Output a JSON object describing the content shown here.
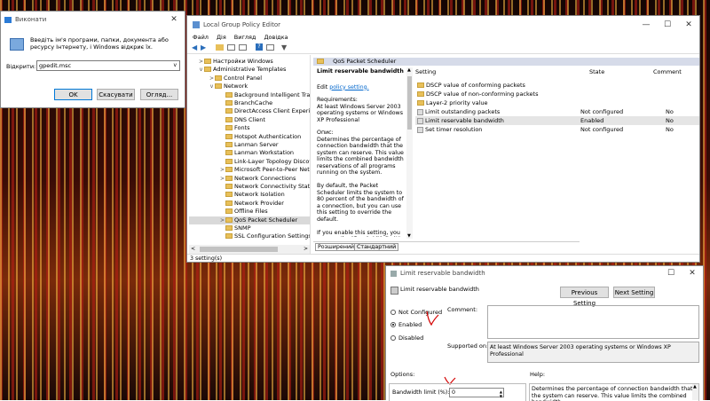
{
  "run_dialog": {
    "title": "Виконати",
    "description": "Введіть ім'я програми, папки, документа або ресурсу Інтернету, і Windows відкриє їх.",
    "open_label": "Відкрити:",
    "open_value": "gpedit.msc",
    "ok_label": "OK",
    "cancel_label": "Скасувати",
    "browse_label": "Огляд..."
  },
  "gpe": {
    "title": "Local Group Policy Editor",
    "menu": [
      "Файл",
      "Дія",
      "Вигляд",
      "Довідка"
    ],
    "tree": [
      {
        "label": "Настройки Windows",
        "depth": 0,
        "arrow": ">"
      },
      {
        "label": "Administrative Templates",
        "depth": 0,
        "arrow": "v"
      },
      {
        "label": "Control Panel",
        "depth": 1,
        "arrow": ">"
      },
      {
        "label": "Network",
        "depth": 1,
        "arrow": "v"
      },
      {
        "label": "Background Intelligent Tran",
        "depth": 2,
        "arrow": ""
      },
      {
        "label": "BranchCache",
        "depth": 2,
        "arrow": ""
      },
      {
        "label": "DirectAccess Client Experien",
        "depth": 2,
        "arrow": ""
      },
      {
        "label": "DNS Client",
        "depth": 2,
        "arrow": ""
      },
      {
        "label": "Fonts",
        "depth": 2,
        "arrow": ""
      },
      {
        "label": "Hotspot Authentication",
        "depth": 2,
        "arrow": ""
      },
      {
        "label": "Lanman Server",
        "depth": 2,
        "arrow": ""
      },
      {
        "label": "Lanman Workstation",
        "depth": 2,
        "arrow": ""
      },
      {
        "label": "Link-Layer Topology Discov",
        "depth": 2,
        "arrow": ""
      },
      {
        "label": "Microsoft Peer-to-Peer Netw",
        "depth": 2,
        "arrow": ">"
      },
      {
        "label": "Network Connections",
        "depth": 2,
        "arrow": ">"
      },
      {
        "label": "Network Connectivity Status",
        "depth": 2,
        "arrow": ""
      },
      {
        "label": "Network Isolation",
        "depth": 2,
        "arrow": ""
      },
      {
        "label": "Network Provider",
        "depth": 2,
        "arrow": ""
      },
      {
        "label": "Offline Files",
        "depth": 2,
        "arrow": ""
      },
      {
        "label": "QoS Packet Scheduler",
        "depth": 2,
        "arrow": ">",
        "selected": true
      },
      {
        "label": "SNMP",
        "depth": 2,
        "arrow": ""
      },
      {
        "label": "SSL Configuration Settings",
        "depth": 2,
        "arrow": ""
      }
    ],
    "header_folder": "QoS Packet Scheduler",
    "desc": {
      "title": "Limit reservable bandwidth",
      "edit_prefix": "Edit ",
      "edit_link": "policy setting.",
      "requirements": "Requirements:\nAt least Windows Server 2003 operating systems or Windows XP Professional",
      "description": "Опис:\nDetermines the percentage of connection bandwidth that the system can reserve. This value limits the combined bandwidth reservations of all programs running on the system.\n\nBy default, the Packet Scheduler limits the system to 80 percent of the bandwidth of a connection, but you can use this setting to override the default.\n\nIf you enable this setting, you can use the \"Bandwidth limit\" box to"
    },
    "columns": {
      "setting": "Setting",
      "state": "State",
      "comment": "Comment"
    },
    "rows": [
      {
        "name": "DSCP value of conforming packets",
        "type": "folder",
        "state": "",
        "comment": ""
      },
      {
        "name": "DSCP value of non-conforming packets",
        "type": "folder",
        "state": "",
        "comment": ""
      },
      {
        "name": "Layer-2 priority value",
        "type": "folder",
        "state": "",
        "comment": ""
      },
      {
        "name": "Limit outstanding packets",
        "type": "setting",
        "state": "Not configured",
        "comment": "No"
      },
      {
        "name": "Limit reservable bandwidth",
        "type": "setting",
        "state": "Enabled",
        "comment": "No",
        "selected": true
      },
      {
        "name": "Set timer resolution",
        "type": "setting",
        "state": "Not configured",
        "comment": "No"
      }
    ],
    "tabs": [
      "Розширений",
      "Стандартний"
    ],
    "status": "3 setting(s)"
  },
  "lrb_dialog": {
    "title": "Limit reservable bandwidth",
    "setting_name": "Limit reservable bandwidth",
    "prev_label": "Previous Setting",
    "next_label": "Next Setting",
    "radio_not_configured": "Not Configured",
    "radio_enabled": "Enabled",
    "radio_disabled": "Disabled",
    "selected_radio": "enabled",
    "comment_label": "Comment:",
    "supported_label": "Supported on:",
    "supported_value": "At least Windows Server 2003 operating systems or Windows XP Professional",
    "options_label": "Options:",
    "help_label": "Help:",
    "bandwidth_label": "Bandwidth limit (%):",
    "bandwidth_value": "0",
    "help_text": "Determines the percentage of connection bandwidth that the system can reserve. This value limits the combined bandwidth"
  },
  "colors": {
    "accent": "#0066cc",
    "selection": "#cce8ff",
    "annotation": "#d40000"
  }
}
